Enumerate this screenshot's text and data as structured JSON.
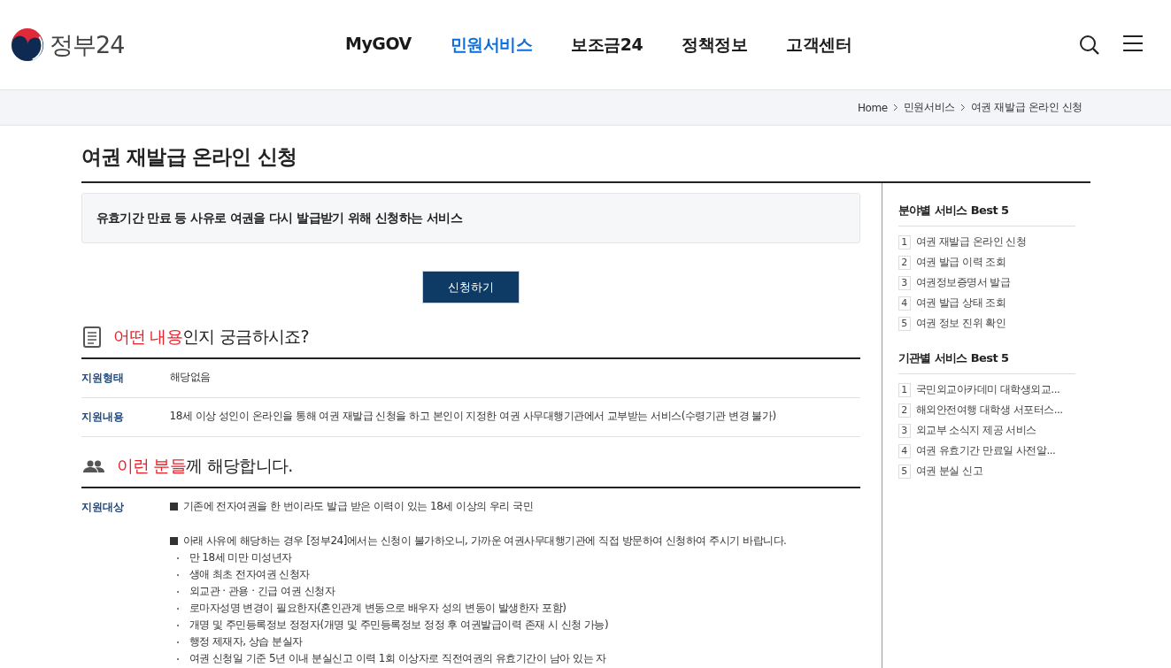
{
  "header": {
    "logo_text": "정부24",
    "nav": [
      {
        "label": "MyGOV",
        "selected": false
      },
      {
        "label": "민원서비스",
        "selected": true
      },
      {
        "label": "보조금24",
        "selected": false
      },
      {
        "label": "정책정보",
        "selected": false
      },
      {
        "label": "고객센터",
        "selected": false
      }
    ]
  },
  "breadcrumb": [
    "Home",
    "민원서비스",
    "여권 재발급 온라인 신청"
  ],
  "page_title": "여권 재발급 온라인 신청",
  "summary": "유효기간 만료 등 사유로 여권을 다시 발급받기 위해 신청하는 서비스",
  "apply_button": "신청하기",
  "sections": [
    {
      "kind": "document",
      "highlight": "어떤 내용",
      "rest": "인지 궁금하시죠?",
      "rows": [
        {
          "label": "지원형태",
          "lines": [
            {
              "kind": "plain",
              "text": "해당없음"
            }
          ]
        },
        {
          "label": "지원내용",
          "lines": [
            {
              "kind": "plain",
              "text": "18세 이상 성인이 온라인을 통해 여권 재발급 신청을 하고 본인이 지정한 여권 사무대행기관에서 교부받는 서비스(수령기관 변경 불가)"
            }
          ]
        }
      ]
    },
    {
      "kind": "people",
      "highlight": "이런 분들",
      "rest": "께 해당합니다.",
      "rows": [
        {
          "label": "지원대상",
          "lines": [
            {
              "kind": "square",
              "text": "기존에 전자여권을 한 번이라도 발급 받은 이력이 있는 18세 이상의 우리 국민"
            },
            {
              "kind": "square",
              "text": "아래 사유에 해당하는 경우 [정부24]에서는 신청이 불가하오니, 가까운 여권사무대행기관에 직접 방문하여 신청하여 주시기 바랍니다."
            },
            {
              "kind": "dot",
              "text": "만 18세 미만 미성년자"
            },
            {
              "kind": "dot",
              "text": "생애 최초 전자여권 신청자"
            },
            {
              "kind": "dot",
              "text": "외교관 · 관용 · 긴급 여권 신청자"
            },
            {
              "kind": "dot",
              "text": "로마자성명 변경이 필요한자(혼인관계 변동으로 배우자 성의 변동이 발생한자 포함)"
            },
            {
              "kind": "dot",
              "text": "개명 및 주민등록정보 정정자(개명 및 주민등록정보 정정 후 여권발급이력 존재 시 신청 가능)"
            },
            {
              "kind": "dot",
              "text": "행정 제재자, 상습 분실자"
            },
            {
              "kind": "dot",
              "text": "여권 신청일 기준 5년 이내 분실신고 이력 1회 이상자로 직전여권의 유효기간이 남아 있는 자"
            }
          ]
        }
      ]
    }
  ],
  "sidebar": [
    {
      "title": "분야별 서비스 Best 5",
      "items": [
        {
          "rank": "1",
          "text": "여권 재발급 온라인 신청"
        },
        {
          "rank": "2",
          "text": "여권 발급 이력 조회"
        },
        {
          "rank": "3",
          "text": "여권정보증명서 발급"
        },
        {
          "rank": "4",
          "text": "여권 발급 상태 조회"
        },
        {
          "rank": "5",
          "text": "여권 정보 진위 확인"
        }
      ]
    },
    {
      "title": "기관별 서비스 Best 5",
      "items": [
        {
          "rank": "1",
          "text": "국민외교아카데미 대학생외교..."
        },
        {
          "rank": "2",
          "text": "해외안전여행 대학생 서포터스..."
        },
        {
          "rank": "3",
          "text": "외교부 소식지 제공 서비스"
        },
        {
          "rank": "4",
          "text": "여권 유효기간 만료일 사전알..."
        },
        {
          "rank": "5",
          "text": "여권 분실 신고"
        }
      ]
    }
  ]
}
